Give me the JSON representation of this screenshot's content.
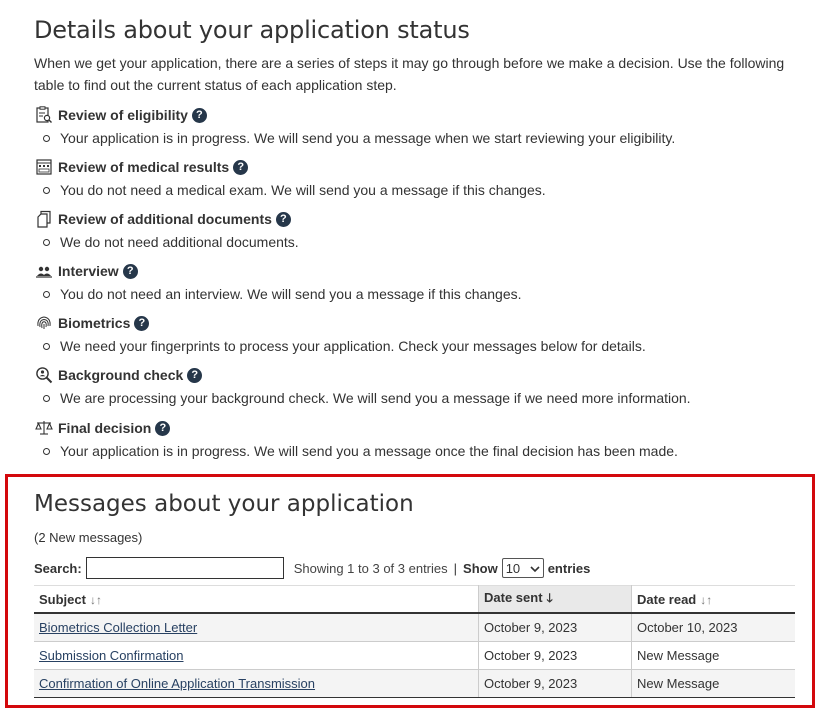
{
  "page": {
    "title": "Details about your application status",
    "intro": "When we get your application, there are a series of steps it may go through before we make a decision. Use the following table to find out the current status of each application step."
  },
  "steps": [
    {
      "title": "Review of eligibility",
      "desc": "Your application is in progress. We will send you a message when we start reviewing your eligibility.",
      "icon": "clipboard-search-icon"
    },
    {
      "title": "Review of medical results",
      "desc": "You do not need a medical exam. We will send you a message if this changes.",
      "icon": "medical-report-icon"
    },
    {
      "title": "Review of additional documents",
      "desc": "We do not need additional documents.",
      "icon": "documents-icon"
    },
    {
      "title": "Interview",
      "desc": "You do not need an interview. We will send you a message if this changes.",
      "icon": "people-icon"
    },
    {
      "title": "Biometrics",
      "desc": "We need your fingerprints to process your application. Check your messages below for details.",
      "icon": "fingerprint-icon"
    },
    {
      "title": "Background check",
      "desc": "We are processing your background check. We will send you a message if we need more information.",
      "icon": "magnifier-person-icon"
    },
    {
      "title": "Final decision",
      "desc": "Your application is in progress. We will send you a message once the final decision has been made.",
      "icon": "scales-icon"
    }
  ],
  "help_glyph": "?",
  "messages": {
    "title": "Messages about your application",
    "new_count": "(2 New messages)",
    "search_label": "Search:",
    "info": "Showing 1 to 3 of 3 entries",
    "separator": "|",
    "show_label": "Show",
    "show_value": "10",
    "entries_label": "entries",
    "columns": {
      "subject": "Subject",
      "date_sent": "Date sent",
      "date_read": "Date read"
    },
    "rows": [
      {
        "subject": "Biometrics Collection Letter",
        "date_sent": "October 9, 2023",
        "date_read": "October 10, 2023"
      },
      {
        "subject": "Submission Confirmation",
        "date_sent": "October 9, 2023",
        "date_read": "New Message"
      },
      {
        "subject": "Confirmation of Online Application Transmission",
        "date_sent": "October 9, 2023",
        "date_read": "New Message"
      }
    ]
  },
  "colors": {
    "highlight_border": "#d3080c",
    "help_badge": "#26374a",
    "link": "#284162"
  }
}
